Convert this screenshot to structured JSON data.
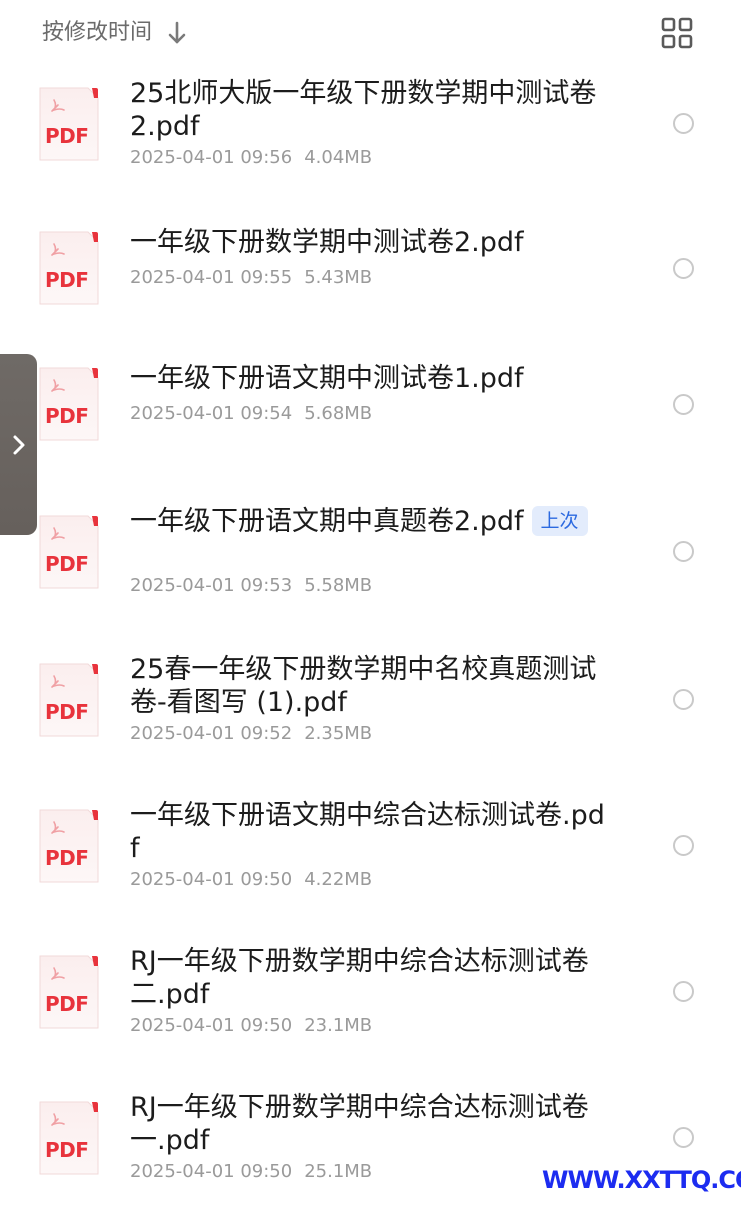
{
  "header": {
    "sort_label": "按修改时间",
    "sort_icon": "arrow-down-icon",
    "view_toggle_icon": "grid-view-icon"
  },
  "files": [
    {
      "name": "25北师大版一年级下册数学期中测试卷2.pdf",
      "date": "2025-04-01 09:56",
      "size": "4.04MB",
      "icon": "pdf-file-icon",
      "icon_label": "PDF"
    },
    {
      "name": "一年级下册数学期中测试卷2.pdf",
      "date": "2025-04-01 09:55",
      "size": "5.43MB",
      "icon": "pdf-file-icon",
      "icon_label": "PDF"
    },
    {
      "name": "一年级下册语文期中测试卷1.pdf",
      "date": "2025-04-01 09:54",
      "size": "5.68MB",
      "icon": "pdf-file-icon",
      "icon_label": "PDF"
    },
    {
      "name": "一年级下册语文期中真题卷2.pdf",
      "badge": "上次",
      "date": "2025-04-01 09:53",
      "size": "5.58MB",
      "icon": "pdf-file-icon",
      "icon_label": "PDF"
    },
    {
      "name": "25春一年级下册数学期中名校真题测试卷-看图写 (1).pdf",
      "date": "2025-04-01 09:52",
      "size": "2.35MB",
      "icon": "pdf-file-icon",
      "icon_label": "PDF"
    },
    {
      "name": "一年级下册语文期中综合达标测试卷.pdf",
      "date": "2025-04-01 09:50",
      "size": "4.22MB",
      "icon": "pdf-file-icon",
      "icon_label": "PDF"
    },
    {
      "name": "RJ一年级下册数学期中综合达标测试卷二.pdf",
      "date": "2025-04-01 09:50",
      "size": "23.1MB",
      "icon": "pdf-file-icon",
      "icon_label": "PDF"
    },
    {
      "name": "RJ一年级下册数学期中综合达标测试卷一.pdf",
      "date": "2025-04-01 09:50",
      "size": "25.1MB",
      "icon": "pdf-file-icon",
      "icon_label": "PDF"
    }
  ],
  "side_panel": {
    "icon": "chevron-right-icon"
  },
  "watermark": {
    "text": "WWW.XXTTQ.COM",
    "color": "#1c2cf0"
  },
  "colors": {
    "pdf_red": "#e8333c",
    "meta_gray": "#9a9a9a",
    "badge_blue": "#2c6ae0",
    "badge_bg": "#e3ecfc"
  }
}
